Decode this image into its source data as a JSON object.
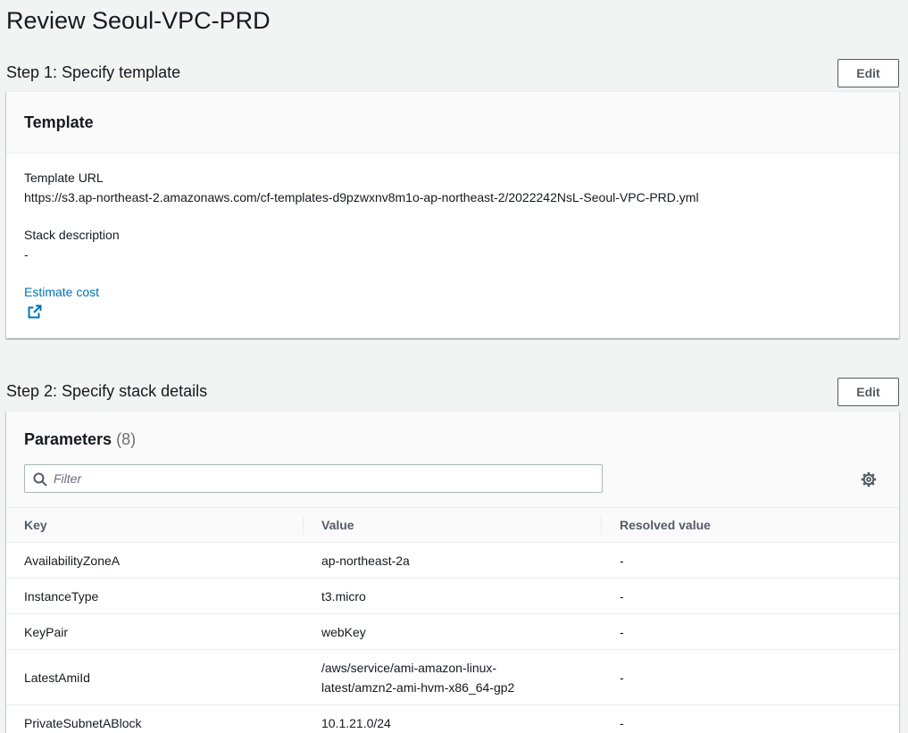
{
  "page_title": "Review Seoul-VPC-PRD",
  "step1": {
    "title": "Step 1: Specify template",
    "edit_label": "Edit",
    "card_title": "Template",
    "template_url_label": "Template URL",
    "template_url_value": "https://s3.ap-northeast-2.amazonaws.com/cf-templates-d9pzwxnv8m1o-ap-northeast-2/2022242NsL-Seoul-VPC-PRD.yml",
    "stack_description_label": "Stack description",
    "stack_description_value": "-",
    "estimate_cost_label": "Estimate cost",
    "estimate_cost_icon": "external-link-icon"
  },
  "step2": {
    "title": "Step 2: Specify stack details",
    "edit_label": "Edit",
    "parameters_title": "Parameters",
    "parameters_count": "(8)",
    "filter_placeholder": "Filter",
    "filter_value": "",
    "settings_icon": "gear-icon",
    "columns": [
      "Key",
      "Value",
      "Resolved value"
    ],
    "rows": [
      {
        "key": "AvailabilityZoneA",
        "value": "ap-northeast-2a",
        "resolved": "-"
      },
      {
        "key": "InstanceType",
        "value": "t3.micro",
        "resolved": "-"
      },
      {
        "key": "KeyPair",
        "value": "webKey",
        "resolved": "-"
      },
      {
        "key": "LatestAmiId",
        "value_line1": "/aws/service/ami-amazon-linux-",
        "value_line2": "latest/amzn2-ami-hvm-x86_64-gp2",
        "resolved": "-"
      },
      {
        "key": "PrivateSubnetABlock",
        "value": "10.1.21.0/24",
        "resolved": "-"
      }
    ]
  },
  "colors": {
    "background": "#f2f3f3",
    "link": "#0073bb",
    "text": "#16191f",
    "muted": "#687078",
    "button_border": "#545b64"
  }
}
